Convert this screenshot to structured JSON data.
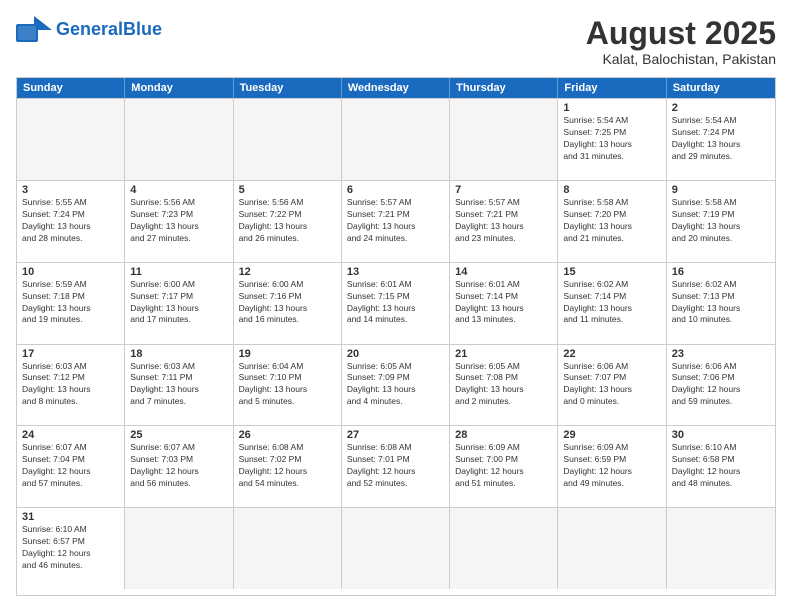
{
  "header": {
    "logo_general": "General",
    "logo_blue": "Blue",
    "month_year": "August 2025",
    "location": "Kalat, Balochistan, Pakistan"
  },
  "weekdays": [
    "Sunday",
    "Monday",
    "Tuesday",
    "Wednesday",
    "Thursday",
    "Friday",
    "Saturday"
  ],
  "rows": [
    [
      {
        "day": "",
        "info": ""
      },
      {
        "day": "",
        "info": ""
      },
      {
        "day": "",
        "info": ""
      },
      {
        "day": "",
        "info": ""
      },
      {
        "day": "",
        "info": ""
      },
      {
        "day": "1",
        "info": "Sunrise: 5:54 AM\nSunset: 7:25 PM\nDaylight: 13 hours\nand 31 minutes."
      },
      {
        "day": "2",
        "info": "Sunrise: 5:54 AM\nSunset: 7:24 PM\nDaylight: 13 hours\nand 29 minutes."
      }
    ],
    [
      {
        "day": "3",
        "info": "Sunrise: 5:55 AM\nSunset: 7:24 PM\nDaylight: 13 hours\nand 28 minutes."
      },
      {
        "day": "4",
        "info": "Sunrise: 5:56 AM\nSunset: 7:23 PM\nDaylight: 13 hours\nand 27 minutes."
      },
      {
        "day": "5",
        "info": "Sunrise: 5:56 AM\nSunset: 7:22 PM\nDaylight: 13 hours\nand 26 minutes."
      },
      {
        "day": "6",
        "info": "Sunrise: 5:57 AM\nSunset: 7:21 PM\nDaylight: 13 hours\nand 24 minutes."
      },
      {
        "day": "7",
        "info": "Sunrise: 5:57 AM\nSunset: 7:21 PM\nDaylight: 13 hours\nand 23 minutes."
      },
      {
        "day": "8",
        "info": "Sunrise: 5:58 AM\nSunset: 7:20 PM\nDaylight: 13 hours\nand 21 minutes."
      },
      {
        "day": "9",
        "info": "Sunrise: 5:58 AM\nSunset: 7:19 PM\nDaylight: 13 hours\nand 20 minutes."
      }
    ],
    [
      {
        "day": "10",
        "info": "Sunrise: 5:59 AM\nSunset: 7:18 PM\nDaylight: 13 hours\nand 19 minutes."
      },
      {
        "day": "11",
        "info": "Sunrise: 6:00 AM\nSunset: 7:17 PM\nDaylight: 13 hours\nand 17 minutes."
      },
      {
        "day": "12",
        "info": "Sunrise: 6:00 AM\nSunset: 7:16 PM\nDaylight: 13 hours\nand 16 minutes."
      },
      {
        "day": "13",
        "info": "Sunrise: 6:01 AM\nSunset: 7:15 PM\nDaylight: 13 hours\nand 14 minutes."
      },
      {
        "day": "14",
        "info": "Sunrise: 6:01 AM\nSunset: 7:14 PM\nDaylight: 13 hours\nand 13 minutes."
      },
      {
        "day": "15",
        "info": "Sunrise: 6:02 AM\nSunset: 7:14 PM\nDaylight: 13 hours\nand 11 minutes."
      },
      {
        "day": "16",
        "info": "Sunrise: 6:02 AM\nSunset: 7:13 PM\nDaylight: 13 hours\nand 10 minutes."
      }
    ],
    [
      {
        "day": "17",
        "info": "Sunrise: 6:03 AM\nSunset: 7:12 PM\nDaylight: 13 hours\nand 8 minutes."
      },
      {
        "day": "18",
        "info": "Sunrise: 6:03 AM\nSunset: 7:11 PM\nDaylight: 13 hours\nand 7 minutes."
      },
      {
        "day": "19",
        "info": "Sunrise: 6:04 AM\nSunset: 7:10 PM\nDaylight: 13 hours\nand 5 minutes."
      },
      {
        "day": "20",
        "info": "Sunrise: 6:05 AM\nSunset: 7:09 PM\nDaylight: 13 hours\nand 4 minutes."
      },
      {
        "day": "21",
        "info": "Sunrise: 6:05 AM\nSunset: 7:08 PM\nDaylight: 13 hours\nand 2 minutes."
      },
      {
        "day": "22",
        "info": "Sunrise: 6:06 AM\nSunset: 7:07 PM\nDaylight: 13 hours\nand 0 minutes."
      },
      {
        "day": "23",
        "info": "Sunrise: 6:06 AM\nSunset: 7:06 PM\nDaylight: 12 hours\nand 59 minutes."
      }
    ],
    [
      {
        "day": "24",
        "info": "Sunrise: 6:07 AM\nSunset: 7:04 PM\nDaylight: 12 hours\nand 57 minutes."
      },
      {
        "day": "25",
        "info": "Sunrise: 6:07 AM\nSunset: 7:03 PM\nDaylight: 12 hours\nand 56 minutes."
      },
      {
        "day": "26",
        "info": "Sunrise: 6:08 AM\nSunset: 7:02 PM\nDaylight: 12 hours\nand 54 minutes."
      },
      {
        "day": "27",
        "info": "Sunrise: 6:08 AM\nSunset: 7:01 PM\nDaylight: 12 hours\nand 52 minutes."
      },
      {
        "day": "28",
        "info": "Sunrise: 6:09 AM\nSunset: 7:00 PM\nDaylight: 12 hours\nand 51 minutes."
      },
      {
        "day": "29",
        "info": "Sunrise: 6:09 AM\nSunset: 6:59 PM\nDaylight: 12 hours\nand 49 minutes."
      },
      {
        "day": "30",
        "info": "Sunrise: 6:10 AM\nSunset: 6:58 PM\nDaylight: 12 hours\nand 48 minutes."
      }
    ],
    [
      {
        "day": "31",
        "info": "Sunrise: 6:10 AM\nSunset: 6:57 PM\nDaylight: 12 hours\nand 46 minutes."
      },
      {
        "day": "",
        "info": ""
      },
      {
        "day": "",
        "info": ""
      },
      {
        "day": "",
        "info": ""
      },
      {
        "day": "",
        "info": ""
      },
      {
        "day": "",
        "info": ""
      },
      {
        "day": "",
        "info": ""
      }
    ]
  ]
}
